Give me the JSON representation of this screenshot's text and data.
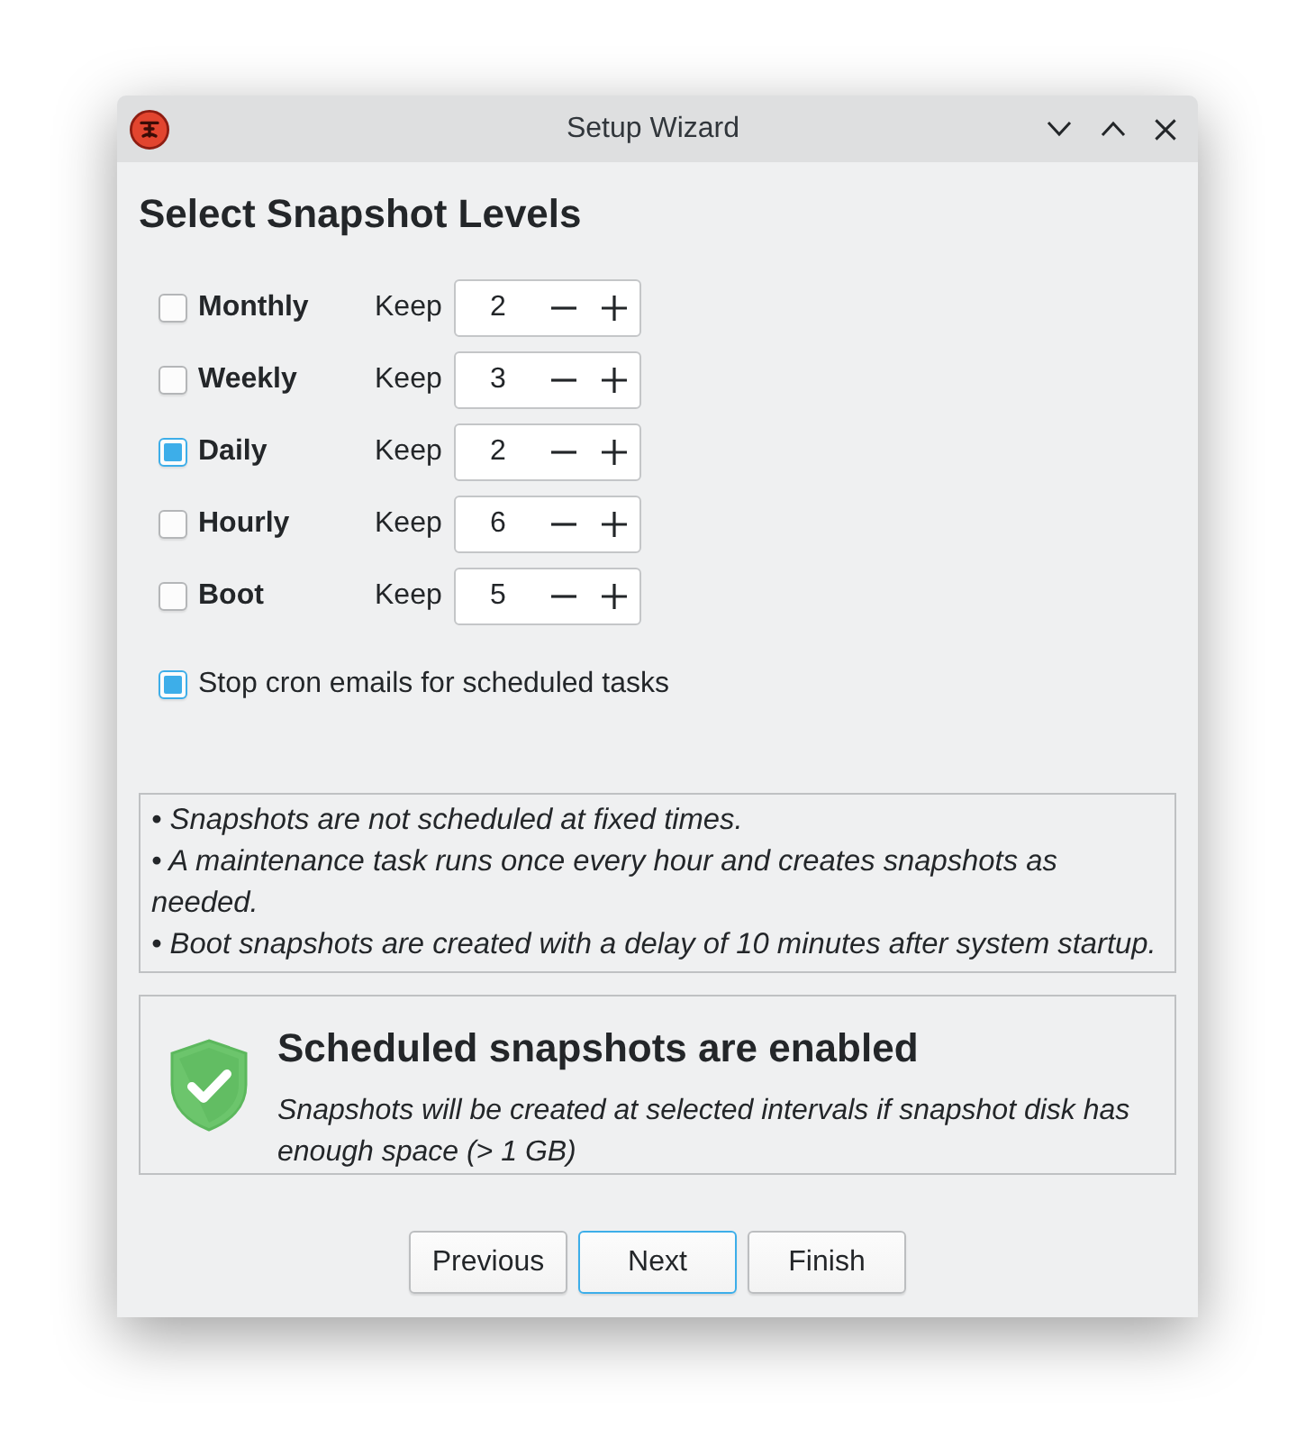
{
  "window": {
    "title": "Setup Wizard"
  },
  "heading": "Select Snapshot Levels",
  "levels": [
    {
      "label": "Monthly",
      "checked": false,
      "keep_label": "Keep",
      "value": "2"
    },
    {
      "label": "Weekly",
      "checked": false,
      "keep_label": "Keep",
      "value": "3"
    },
    {
      "label": "Daily",
      "checked": true,
      "keep_label": "Keep",
      "value": "2"
    },
    {
      "label": "Hourly",
      "checked": false,
      "keep_label": "Keep",
      "value": "6"
    },
    {
      "label": "Boot",
      "checked": false,
      "keep_label": "Keep",
      "value": "5"
    }
  ],
  "cron_option": {
    "label": "Stop cron emails for scheduled tasks",
    "checked": true
  },
  "notes": [
    "• Snapshots are not scheduled at fixed times.",
    "• A maintenance task runs once every hour and creates snapshots as needed.",
    "• Boot snapshots are created with a delay of 10 minutes after system startup."
  ],
  "status": {
    "kind": "enabled",
    "title": "Scheduled snapshots are enabled",
    "message": "Snapshots will be created at selected intervals if snapshot disk has enough space (> 1 GB)"
  },
  "buttons": [
    {
      "label": "Previous",
      "focused": false
    },
    {
      "label": "Next",
      "focused": true
    },
    {
      "label": "Finish",
      "focused": false
    }
  ]
}
